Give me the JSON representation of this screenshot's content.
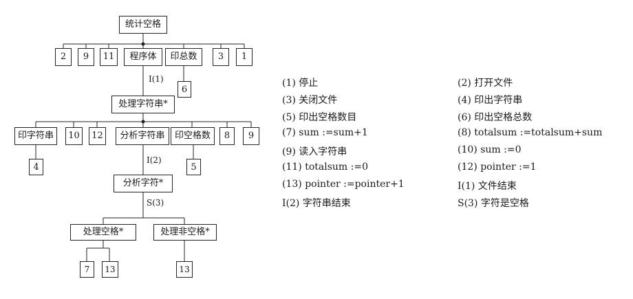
{
  "diagram": {
    "root": "统计空格",
    "level1": [
      "2",
      "9",
      "11",
      "程序体",
      "印总数",
      "3",
      "1"
    ],
    "print_total_child": "6",
    "process_string": "处理字符串*",
    "level2": [
      "印字符串",
      "10",
      "12",
      "分析字符串",
      "印空格数",
      "8",
      "9"
    ],
    "print_string_child": "4",
    "print_space_count_child": "5",
    "analyze_char": "分析字符*",
    "process_space": "处理空格*",
    "process_nonspace": "处理非空格*",
    "space_children": [
      "7",
      "13"
    ],
    "nonspace_child": "13",
    "cond_i1": "I(1)",
    "cond_i2": "I(2)",
    "cond_s3": "S(3)"
  },
  "legend": {
    "left": [
      "(1) 停止",
      "(3) 关闭文件",
      "(5) 印出空格数目",
      "(7) sum :=sum+1",
      "(9) 读入字符串",
      "(11) totalsum :=0",
      "(13) pointer :=pointer+1",
      "I(2) 字符串结束"
    ],
    "right": [
      "(2) 打开文件",
      "(4) 印出字符串",
      "(6) 印出空格总数",
      "(8) totalsum :=totalsum+sum",
      "(10) sum :=0",
      "(12) pointer :=1",
      "I(1) 文件结束",
      "S(3) 字符是空格"
    ]
  }
}
